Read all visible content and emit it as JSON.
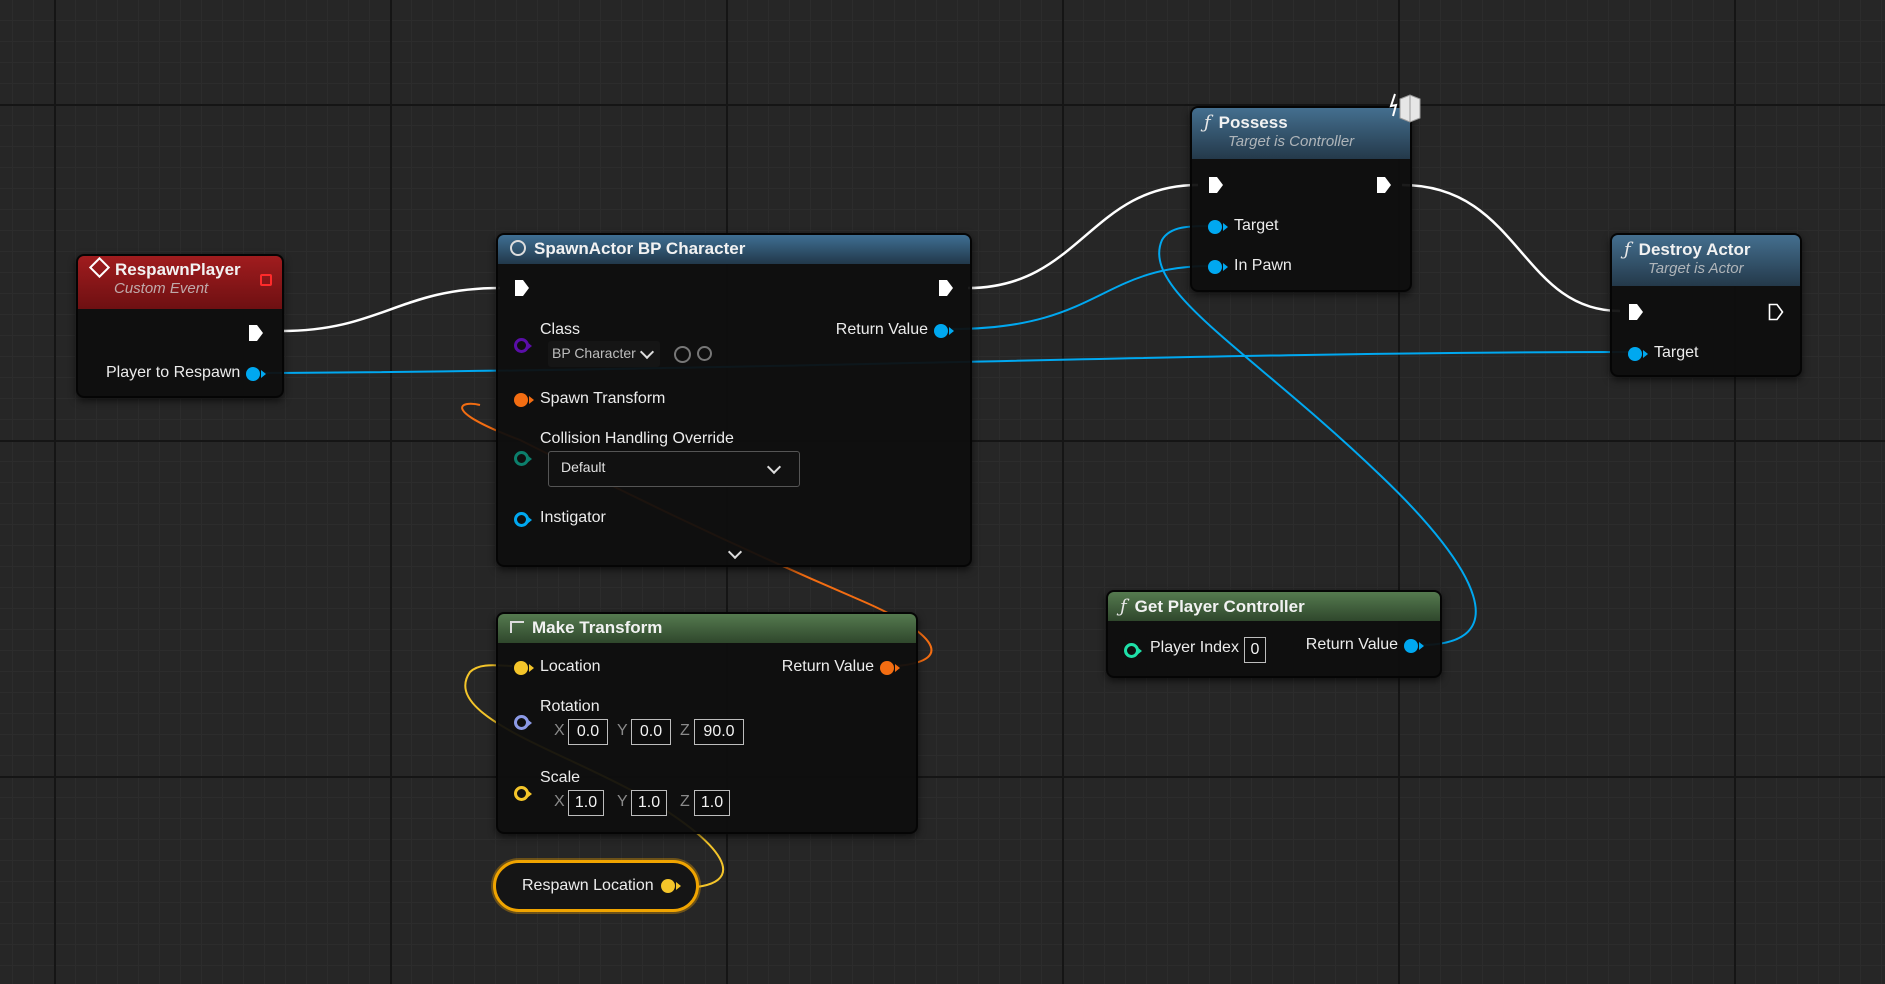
{
  "colors": {
    "exec_wire": "#ffffff",
    "object_pin": "#00a8f0",
    "class_pin": "#5a0ea8",
    "struct_pin": "#f36d12",
    "vector_pin": "#f4c52a",
    "rotator_pin": "#8c9ae6",
    "byte_pin": "#0c7f6c",
    "int_pin": "#1fe0a8",
    "event_header": "#8d1416",
    "function_header": "#3d6a8a",
    "pure_header": "#4c6e45"
  },
  "nodes": {
    "respawn_player": {
      "title": "RespawnPlayer",
      "subtitle": "Custom Event",
      "icon": "event-diamond-icon",
      "player_to_respawn": "Player to Respawn"
    },
    "spawn_actor": {
      "title": "SpawnActor BP Character",
      "icon": "spawn-actor-icon",
      "class_label": "Class",
      "class_value": "BP Character",
      "return_value": "Return Value",
      "spawn_transform": "Spawn Transform",
      "collision_label": "Collision Handling Override",
      "collision_value": "Default",
      "instigator": "Instigator"
    },
    "make_transform": {
      "title": "Make Transform",
      "icon": "make-struct-icon",
      "location": "Location",
      "return_value": "Return Value",
      "rotation": "Rotation",
      "rotation_values": {
        "x": "0.0",
        "y": "0.0",
        "z": "90.0"
      },
      "scale": "Scale",
      "scale_values": {
        "x": "1.0",
        "y": "1.0",
        "z": "1.0"
      },
      "axis_x": "X",
      "axis_y": "Y",
      "axis_z": "Z"
    },
    "respawn_location": {
      "label": "Respawn Location"
    },
    "possess": {
      "title": "Possess",
      "subtitle": "Target is Controller",
      "icon": "function-icon",
      "target": "Target",
      "in_pawn": "In Pawn"
    },
    "get_player_controller": {
      "title": "Get Player Controller",
      "icon": "function-icon",
      "player_index_label": "Player Index",
      "player_index_value": "0",
      "return_value": "Return Value"
    },
    "destroy_actor": {
      "title": "Destroy Actor",
      "subtitle": "Target is Actor",
      "icon": "function-icon",
      "target": "Target"
    }
  }
}
